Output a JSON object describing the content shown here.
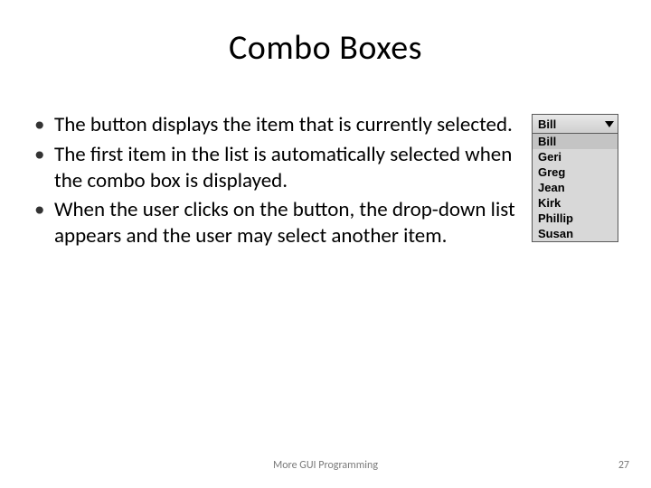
{
  "title": "Combo Boxes",
  "bullets": [
    "The button displays the item that is currently selected.",
    "The first item in the list is automatically selected when the combo box is displayed.",
    "When the user clicks on the button, the drop-down list appears and the user may select another item."
  ],
  "combo": {
    "selected": "Bill",
    "options": [
      "Bill",
      "Geri",
      "Greg",
      "Jean",
      "Kirk",
      "Phillip",
      "Susan"
    ]
  },
  "footer": {
    "center": "More GUI Programming",
    "page": "27"
  }
}
